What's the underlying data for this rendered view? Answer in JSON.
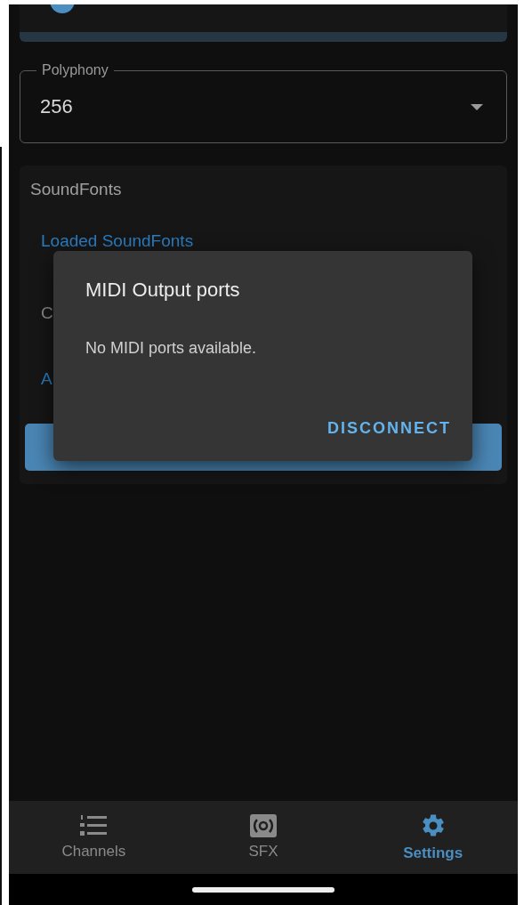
{
  "polyphony": {
    "label": "Polyphony",
    "value": "256"
  },
  "soundfonts": {
    "title": "SoundFonts",
    "items": [
      {
        "kind": "link",
        "text": "Loaded SoundFonts"
      },
      {
        "kind": "label",
        "text": "C"
      },
      {
        "kind": "link",
        "text": "A"
      }
    ]
  },
  "dialog": {
    "title": "MIDI Output ports",
    "message": "No MIDI ports available.",
    "actions": [
      "DISCONNECT"
    ]
  },
  "nav": [
    {
      "kind": "channels",
      "label": "Channels",
      "selected": false
    },
    {
      "kind": "sfx",
      "label": "SFX",
      "selected": false
    },
    {
      "kind": "settings",
      "label": "Settings",
      "selected": true
    }
  ]
}
